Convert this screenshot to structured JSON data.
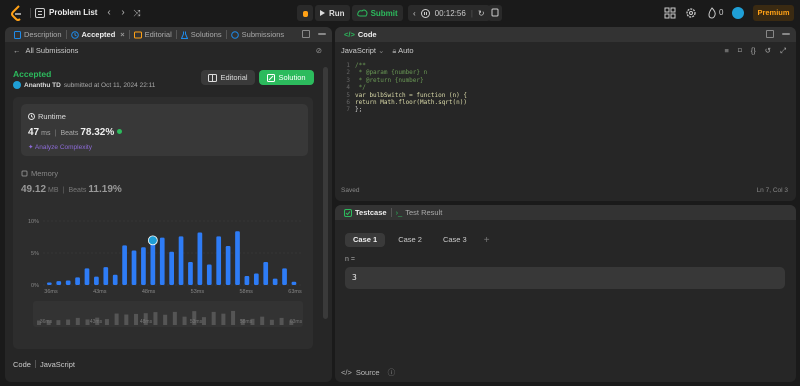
{
  "topbar": {
    "problem_list": "Problem List",
    "run": "Run",
    "submit": "Submit",
    "timer": "00:12:56",
    "streak": "0",
    "premium": "Premium"
  },
  "left_tabs": [
    {
      "label": "Description",
      "icon": "document-icon"
    },
    {
      "label": "Accepted",
      "icon": "clock-icon",
      "active": true
    },
    {
      "label": "Editorial",
      "icon": "book-icon"
    },
    {
      "label": "Solutions",
      "icon": "flask-icon"
    },
    {
      "label": "Submissions",
      "icon": "history-icon"
    }
  ],
  "submission": {
    "back_label": "All Submissions",
    "status": "Accepted",
    "user": "Ananthu TD",
    "submitted_text": "submitted at Oct 11, 2024 22:11",
    "editorial_btn": "Editorial",
    "solution_btn": "Solution"
  },
  "runtime": {
    "label": "Runtime",
    "value": "47",
    "unit": "ms",
    "beats_label": "Beats",
    "beats": "78.32%",
    "analyze": "Analyze Complexity"
  },
  "memory": {
    "label": "Memory",
    "value": "49.12",
    "unit": "MB",
    "beats_label": "Beats",
    "beats": "11.19%"
  },
  "chart_data": {
    "type": "bar",
    "y_ticks": [
      "10%",
      "5%",
      "0%"
    ],
    "ylim": [
      0,
      10
    ],
    "x_ticks": [
      "36ms",
      "43ms",
      "48ms",
      "53ms",
      "58ms",
      "63ms"
    ],
    "x_mini_ticks": [
      "36ms",
      "43ms",
      "48ms",
      "53ms",
      "58ms",
      "63ms"
    ],
    "values": [
      0.4,
      0.6,
      0.7,
      1.2,
      2.6,
      1.3,
      2.8,
      1.6,
      6.2,
      5.4,
      5.9,
      6.5,
      7.4,
      5.2,
      7.6,
      3.6,
      8.2,
      3.2,
      7.6,
      6.1,
      8.4,
      1.4,
      1.8,
      3.6,
      1.0,
      2.6,
      0.5
    ],
    "highlight_index": 11,
    "color": "#2e7cf6"
  },
  "code_footer": {
    "label": "Code",
    "lang": "JavaScript"
  },
  "editor": {
    "tab": "Code",
    "lang": "JavaScript",
    "mode": "Auto",
    "lines": [
      "/**",
      " * @param {number} n",
      " * @return {number}",
      " */",
      "var bulbSwitch = function (n) {",
      "return Math.floor(Math.sqrt(n))",
      "};"
    ],
    "saved": "Saved",
    "position": "Ln 7, Col 3"
  },
  "tests": {
    "tab_testcase": "Testcase",
    "tab_result": "Test Result",
    "cases": [
      "Case 1",
      "Case 2",
      "Case 3"
    ],
    "n_label": "n =",
    "n_value": "3",
    "source": "Source"
  }
}
